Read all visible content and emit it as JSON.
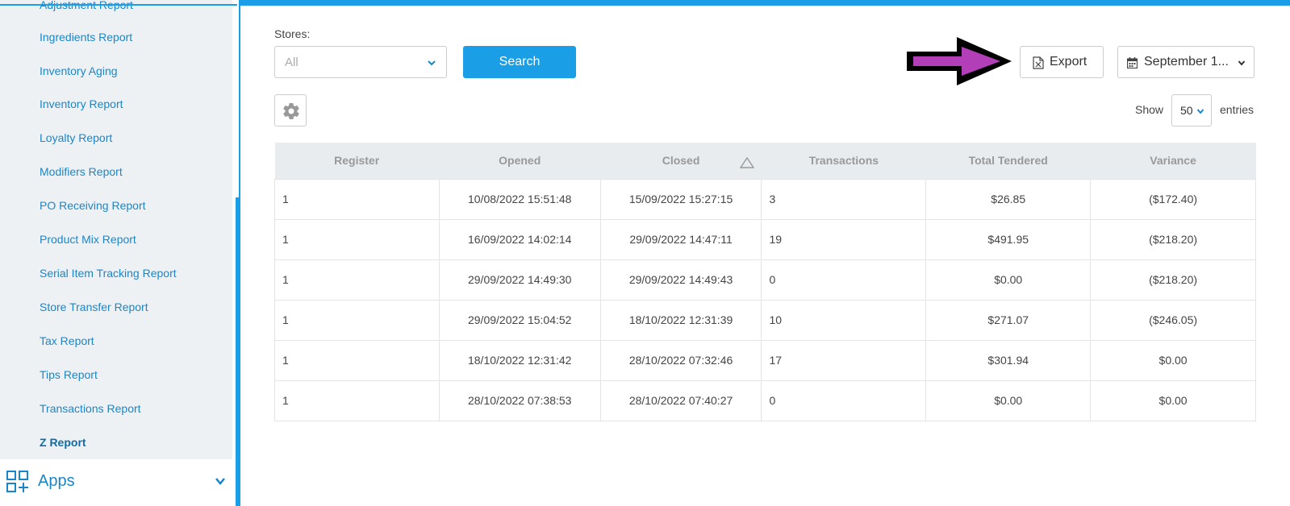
{
  "sidebar": {
    "items": [
      {
        "label": "Adjustment Report"
      },
      {
        "label": "Ingredients Report"
      },
      {
        "label": "Inventory Aging"
      },
      {
        "label": "Inventory Report"
      },
      {
        "label": "Loyalty Report"
      },
      {
        "label": "Modifiers Report"
      },
      {
        "label": "PO Receiving Report"
      },
      {
        "label": "Product Mix Report"
      },
      {
        "label": "Serial Item Tracking Report"
      },
      {
        "label": "Store Transfer Report"
      },
      {
        "label": "Tax Report"
      },
      {
        "label": "Tips Report"
      },
      {
        "label": "Transactions Report"
      },
      {
        "label": "Z Report"
      }
    ],
    "active_item": "Z Report",
    "apps_label": "Apps"
  },
  "filters": {
    "stores_label": "Stores:",
    "stores_value": "All",
    "search_label": "Search"
  },
  "toolbar": {
    "export_label": "Export",
    "date_label": "September 1..."
  },
  "entries": {
    "show_label": "Show",
    "value": "50",
    "entries_label": "entries"
  },
  "table": {
    "columns": [
      "Register",
      "Opened",
      "Closed",
      "Transactions",
      "Total Tendered",
      "Variance"
    ],
    "sorted_column": "Closed",
    "rows": [
      [
        "1",
        "10/08/2022 15:51:48",
        "15/09/2022 15:27:15",
        "3",
        "$26.85",
        "($172.40)"
      ],
      [
        "1",
        "16/09/2022 14:02:14",
        "29/09/2022 14:47:11",
        "19",
        "$491.95",
        "($218.20)"
      ],
      [
        "1",
        "29/09/2022 14:49:30",
        "29/09/2022 14:49:43",
        "0",
        "$0.00",
        "($218.20)"
      ],
      [
        "1",
        "29/09/2022 15:04:52",
        "18/10/2022 12:31:39",
        "10",
        "$271.07",
        "($246.05)"
      ],
      [
        "1",
        "18/10/2022 12:31:42",
        "28/10/2022 07:32:46",
        "17",
        "$301.94",
        "$0.00"
      ],
      [
        "1",
        "28/10/2022 07:38:53",
        "28/10/2022 07:40:27",
        "0",
        "$0.00",
        "$0.00"
      ]
    ]
  },
  "colors": {
    "accent": "#1a9ee6",
    "link": "#1a86c8",
    "arrow_fill": "#b23fb8"
  }
}
